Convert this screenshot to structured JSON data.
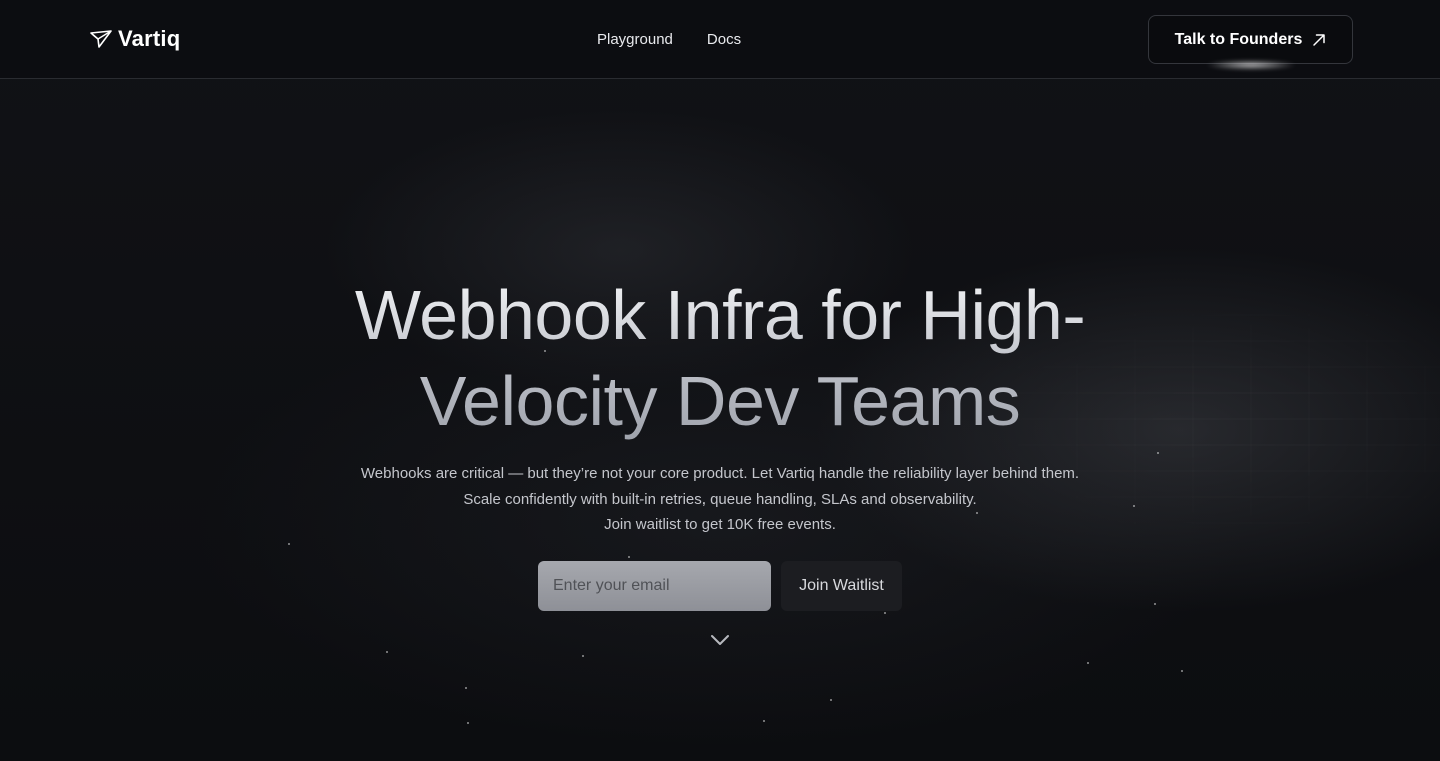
{
  "brand": {
    "name": "Vartiq",
    "logo_icon": "paper-plane-icon"
  },
  "nav": {
    "items": [
      "Playground",
      "Docs"
    ]
  },
  "header": {
    "cta_label": "Talk to Founders",
    "cta_icon": "arrow-up-right-icon"
  },
  "hero": {
    "title_line1": "Webhook Infra for High-",
    "title_line2": "Velocity Dev Teams",
    "subtitle_line1": "Webhooks are critical — but they’re not your core product. Let Vartiq handle the reliability layer behind them.",
    "subtitle_line2": "Scale confidently with built-in retries, queue handling, SLAs and observability.",
    "subtitle_line3": "Join waitlist to get 10K free events."
  },
  "waitlist": {
    "email_placeholder": "Enter your email",
    "email_value": "",
    "submit_label": "Join Waitlist"
  },
  "scroll": {
    "icon": "chevron-down-icon"
  },
  "colors": {
    "background": "#0d0e11",
    "border": "#2a2c31",
    "text": "#e6e7ea"
  }
}
